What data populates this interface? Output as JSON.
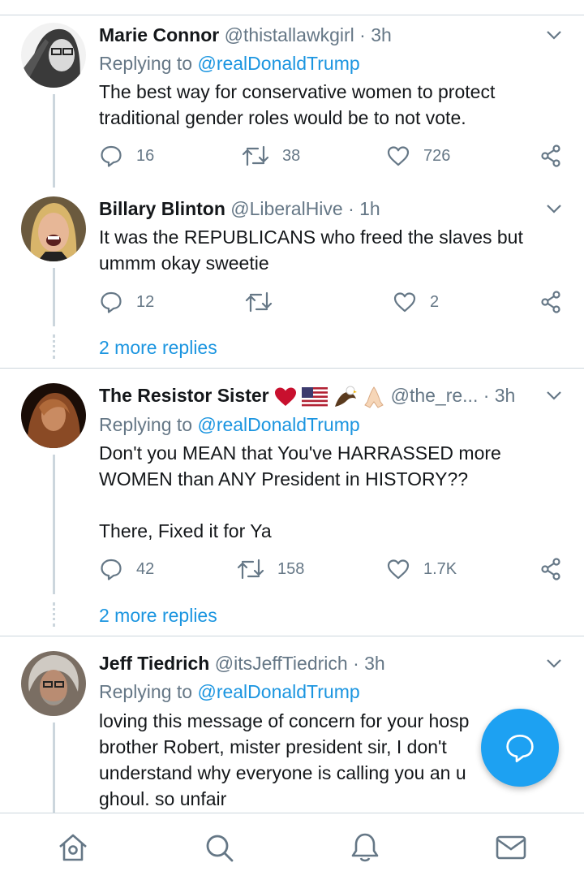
{
  "tweets": [
    {
      "name": "Marie Connor",
      "handle": "@thistallawkgirl",
      "time": "· 3h",
      "replying_prefix": "Replying to",
      "replying_to": "@realDonaldTrump",
      "text": "The best way for conservative women to protect traditional gender roles would be to not vote.",
      "replies": "16",
      "retweets": "38",
      "likes": "726"
    },
    {
      "name": "Billary Blinton",
      "handle": "@LiberalHive",
      "time": "· 1h",
      "text": "It was the REPUBLICANS who freed the slaves but ummm okay sweetie",
      "replies": "12",
      "retweets": "",
      "likes": "2",
      "more_replies": "2 more replies"
    },
    {
      "name": "The Resistor Sister",
      "handle": "@the_re...",
      "time": "· 3h",
      "replying_prefix": "Replying to",
      "replying_to": "@realDonaldTrump",
      "text": "Don't you MEAN that You've HARRASSED more WOMEN than ANY President in HISTORY??\n\nThere, Fixed it for Ya",
      "replies": "42",
      "retweets": "158",
      "likes": "1.7K",
      "more_replies": "2 more replies"
    },
    {
      "name": "Jeff Tiedrich",
      "handle": "@itsJeffTiedrich",
      "time": "· 3h",
      "replying_prefix": "Replying to",
      "replying_to": "@realDonaldTrump",
      "text": "loving this message of concern for your hosp      d\nbrother Robert, mister president sir, I don't\nunderstand why everyone is calling you an u          g\nghoul. so unfair"
    }
  ],
  "icons": {
    "reply": "reply-icon",
    "retweet": "retweet-icon",
    "like": "heart-icon",
    "share": "share-icon",
    "compose": "compose-reply-icon",
    "nav": [
      "home-icon",
      "search-icon",
      "notifications-icon",
      "messages-icon"
    ]
  },
  "colors": {
    "accent": "#1da1f2",
    "link": "#1b95e0",
    "muted": "#657786",
    "divider": "#ccd6dd"
  }
}
